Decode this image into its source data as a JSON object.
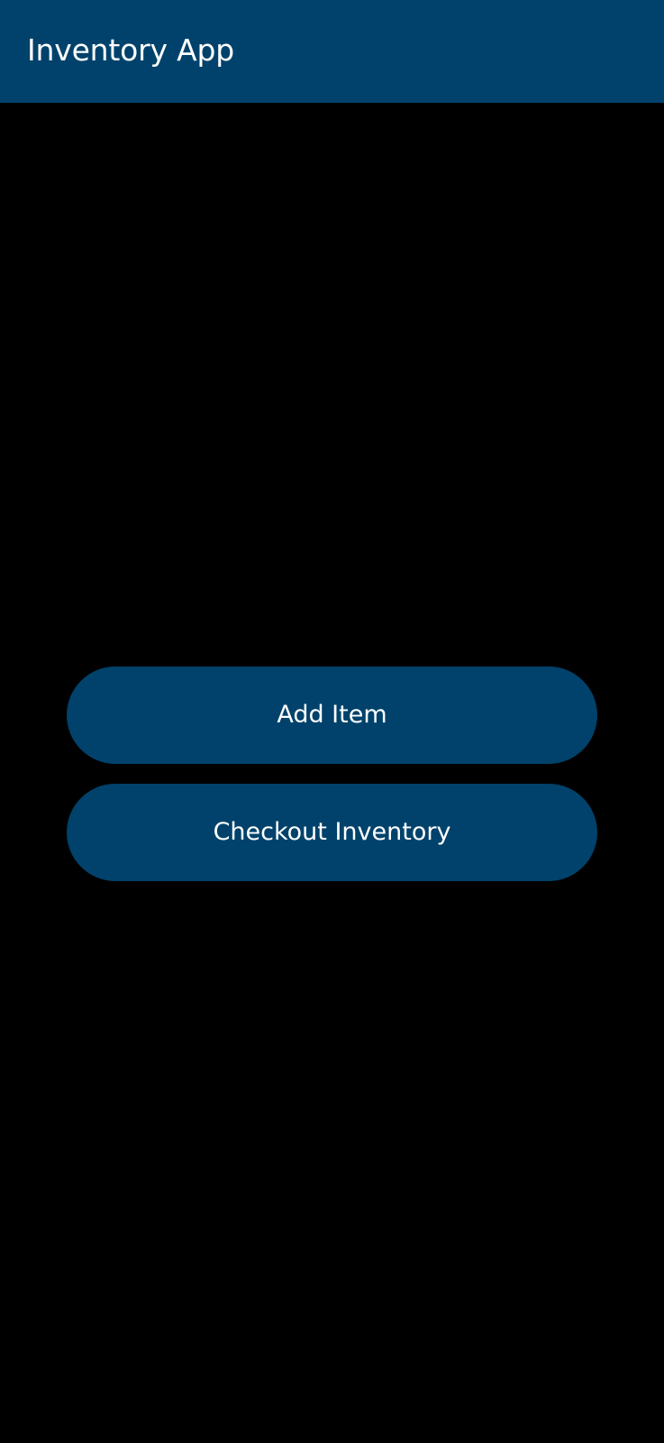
{
  "app_bar": {
    "title": "Inventory App"
  },
  "actions": {
    "add_item_label": "Add Item",
    "checkout_inventory_label": "Checkout Inventory"
  },
  "colors": {
    "primary": "#00426B",
    "background": "#000000",
    "text": "#FFFFFF"
  }
}
